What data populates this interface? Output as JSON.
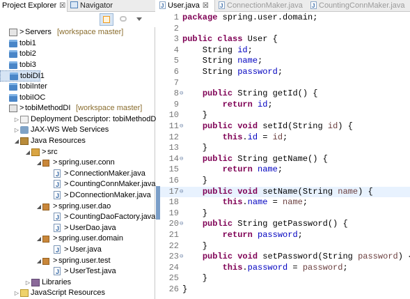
{
  "left_panel": {
    "tabs": [
      {
        "label": "Project Explorer",
        "close": "☒",
        "active": true
      },
      {
        "label": "Navigator",
        "active": false
      }
    ],
    "toolbar": [
      "collapse-all-icon",
      "link-with-editor-icon",
      "view-menu-icon"
    ],
    "tree": [
      {
        "indent": 0,
        "twisty": "",
        "icon": "server-folder-icon",
        "label": "Servers",
        "decoration": "[workspace master]",
        "prefix": ">"
      },
      {
        "indent": 0,
        "twisty": "",
        "icon": "project-folder-icon",
        "label": "tobi1"
      },
      {
        "indent": 0,
        "twisty": "",
        "icon": "project-folder-icon",
        "label": "tobi2"
      },
      {
        "indent": 0,
        "twisty": "",
        "icon": "project-folder-icon",
        "label": "tobi3"
      },
      {
        "indent": 0,
        "twisty": "",
        "icon": "project-folder-icon",
        "label": "tobiDI1",
        "selected": true
      },
      {
        "indent": 0,
        "twisty": "",
        "icon": "project-folder-icon",
        "label": "tobiInter"
      },
      {
        "indent": 0,
        "twisty": "",
        "icon": "project-folder-icon",
        "label": "tobiIOC"
      },
      {
        "indent": 0,
        "twisty": "",
        "icon": "java-project-icon",
        "label": "tobiMethodDI",
        "decoration": "[workspace master]",
        "prefix": ">"
      },
      {
        "indent": 1,
        "twisty": "▷",
        "icon": "deployment-descriptor-icon",
        "label": "Deployment Descriptor: tobiMethodDI"
      },
      {
        "indent": 1,
        "twisty": "▷",
        "icon": "jaxws-icon",
        "label": "JAX-WS Web Services"
      },
      {
        "indent": 1,
        "twisty": "◢",
        "icon": "java-resources-icon",
        "label": "Java Resources"
      },
      {
        "indent": 2,
        "twisty": "◢",
        "icon": "source-folder-icon",
        "label": "src",
        "prefix": ">"
      },
      {
        "indent": 3,
        "twisty": "◢",
        "icon": "package-icon",
        "label": "spring.user.conn",
        "prefix": ">"
      },
      {
        "indent": 4,
        "twisty": "",
        "icon": "java-file-icon",
        "label": "ConnectionMaker.java",
        "prefix": ">"
      },
      {
        "indent": 4,
        "twisty": "",
        "icon": "java-file-icon",
        "label": "CountingConnMaker.java",
        "prefix": ">"
      },
      {
        "indent": 4,
        "twisty": "",
        "icon": "java-file-icon",
        "label": "DConnectionMaker.java",
        "prefix": ">"
      },
      {
        "indent": 3,
        "twisty": "◢",
        "icon": "package-icon",
        "label": "spring.user.dao",
        "prefix": ">"
      },
      {
        "indent": 4,
        "twisty": "",
        "icon": "java-file-icon",
        "label": "CountingDaoFactory.java",
        "prefix": ">"
      },
      {
        "indent": 4,
        "twisty": "",
        "icon": "java-file-icon",
        "label": "UserDao.java",
        "prefix": ">"
      },
      {
        "indent": 3,
        "twisty": "◢",
        "icon": "package-icon",
        "label": "spring.user.domain",
        "prefix": ">"
      },
      {
        "indent": 4,
        "twisty": "",
        "icon": "java-file-icon",
        "label": "User.java",
        "prefix": ">"
      },
      {
        "indent": 3,
        "twisty": "◢",
        "icon": "package-icon",
        "label": "spring.user.test",
        "prefix": ">"
      },
      {
        "indent": 4,
        "twisty": "",
        "icon": "java-file-icon",
        "label": "UserTest.java",
        "prefix": ">"
      },
      {
        "indent": 2,
        "twisty": "▷",
        "icon": "libraries-icon",
        "label": "Libraries"
      },
      {
        "indent": 1,
        "twisty": "▷",
        "icon": "javascript-resources-icon",
        "label": "JavaScript Resources"
      }
    ]
  },
  "editor": {
    "tabs": [
      {
        "label": "User.java",
        "close": "☒",
        "active": true
      },
      {
        "label": "ConnectionMaker.java",
        "active": false
      },
      {
        "label": "CountingConnMaker.java",
        "active": false
      }
    ],
    "current_line": 17,
    "lines": [
      {
        "n": "1",
        "fold": "",
        "tokens": [
          [
            "kw",
            "package"
          ],
          [
            "t",
            " spring.user.domain;"
          ]
        ]
      },
      {
        "n": "2",
        "fold": "",
        "tokens": []
      },
      {
        "n": "3",
        "fold": "",
        "tokens": [
          [
            "kw",
            "public"
          ],
          [
            "t",
            " "
          ],
          [
            "kw",
            "class"
          ],
          [
            "t",
            " User {"
          ]
        ]
      },
      {
        "n": "4",
        "fold": "",
        "tokens": [
          [
            "t",
            "    String "
          ],
          [
            "fld",
            "id"
          ],
          [
            "t",
            ";"
          ]
        ]
      },
      {
        "n": "5",
        "fold": "",
        "tokens": [
          [
            "t",
            "    String "
          ],
          [
            "fld",
            "name"
          ],
          [
            "t",
            ";"
          ]
        ]
      },
      {
        "n": "6",
        "fold": "",
        "tokens": [
          [
            "t",
            "    String "
          ],
          [
            "fld",
            "password"
          ],
          [
            "t",
            ";"
          ]
        ]
      },
      {
        "n": "7",
        "fold": "",
        "tokens": []
      },
      {
        "n": "8",
        "fold": "⊖",
        "tokens": [
          [
            "t",
            "    "
          ],
          [
            "kw",
            "public"
          ],
          [
            "t",
            " String getId() {"
          ]
        ]
      },
      {
        "n": "9",
        "fold": "",
        "tokens": [
          [
            "t",
            "        "
          ],
          [
            "kw",
            "return"
          ],
          [
            "t",
            " "
          ],
          [
            "fld",
            "id"
          ],
          [
            "t",
            ";"
          ]
        ]
      },
      {
        "n": "10",
        "fold": "",
        "tokens": [
          [
            "t",
            "    }"
          ]
        ]
      },
      {
        "n": "11",
        "fold": "⊖",
        "tokens": [
          [
            "t",
            "    "
          ],
          [
            "kw",
            "public"
          ],
          [
            "t",
            " "
          ],
          [
            "kw",
            "void"
          ],
          [
            "t",
            " setId(String "
          ],
          [
            "par",
            "id"
          ],
          [
            "t",
            ") {"
          ]
        ]
      },
      {
        "n": "12",
        "fold": "",
        "tokens": [
          [
            "t",
            "        "
          ],
          [
            "kw",
            "this"
          ],
          [
            "t",
            "."
          ],
          [
            "fld",
            "id"
          ],
          [
            "t",
            " = "
          ],
          [
            "par",
            "id"
          ],
          [
            "t",
            ";"
          ]
        ]
      },
      {
        "n": "13",
        "fold": "",
        "tokens": [
          [
            "t",
            "    }"
          ]
        ]
      },
      {
        "n": "14",
        "fold": "⊖",
        "tokens": [
          [
            "t",
            "    "
          ],
          [
            "kw",
            "public"
          ],
          [
            "t",
            " String getName() {"
          ]
        ]
      },
      {
        "n": "15",
        "fold": "",
        "tokens": [
          [
            "t",
            "        "
          ],
          [
            "kw",
            "return"
          ],
          [
            "t",
            " "
          ],
          [
            "fld",
            "name"
          ],
          [
            "t",
            ";"
          ]
        ]
      },
      {
        "n": "16",
        "fold": "",
        "tokens": [
          [
            "t",
            "    }"
          ]
        ]
      },
      {
        "n": "17",
        "fold": "⊖",
        "tokens": [
          [
            "t",
            "    "
          ],
          [
            "kw",
            "public"
          ],
          [
            "t",
            " "
          ],
          [
            "kw",
            "void"
          ],
          [
            "t",
            " setName(String "
          ],
          [
            "par",
            "name"
          ],
          [
            "t",
            ") {"
          ]
        ]
      },
      {
        "n": "18",
        "fold": "",
        "tokens": [
          [
            "t",
            "        "
          ],
          [
            "kw",
            "this"
          ],
          [
            "t",
            "."
          ],
          [
            "fld",
            "name"
          ],
          [
            "t",
            " = "
          ],
          [
            "par",
            "name"
          ],
          [
            "t",
            ";"
          ]
        ]
      },
      {
        "n": "19",
        "fold": "",
        "tokens": [
          [
            "t",
            "    }"
          ]
        ]
      },
      {
        "n": "20",
        "fold": "⊖",
        "tokens": [
          [
            "t",
            "    "
          ],
          [
            "kw",
            "public"
          ],
          [
            "t",
            " String getPassword() {"
          ]
        ]
      },
      {
        "n": "21",
        "fold": "",
        "tokens": [
          [
            "t",
            "        "
          ],
          [
            "kw",
            "return"
          ],
          [
            "t",
            " "
          ],
          [
            "fld",
            "password"
          ],
          [
            "t",
            ";"
          ]
        ]
      },
      {
        "n": "22",
        "fold": "",
        "tokens": [
          [
            "t",
            "    }"
          ]
        ]
      },
      {
        "n": "23",
        "fold": "⊖",
        "tokens": [
          [
            "t",
            "    "
          ],
          [
            "kw",
            "public"
          ],
          [
            "t",
            " "
          ],
          [
            "kw",
            "void"
          ],
          [
            "t",
            " setPassword(String "
          ],
          [
            "par",
            "password"
          ],
          [
            "t",
            ") {"
          ]
        ]
      },
      {
        "n": "24",
        "fold": "",
        "tokens": [
          [
            "t",
            "        "
          ],
          [
            "kw",
            "this"
          ],
          [
            "t",
            "."
          ],
          [
            "fld",
            "password"
          ],
          [
            "t",
            " = "
          ],
          [
            "par",
            "password"
          ],
          [
            "t",
            ";"
          ]
        ]
      },
      {
        "n": "25",
        "fold": "",
        "tokens": [
          [
            "t",
            "    }"
          ]
        ]
      },
      {
        "n": "26",
        "fold": "",
        "tokens": [
          [
            "t",
            "}"
          ]
        ]
      }
    ]
  }
}
